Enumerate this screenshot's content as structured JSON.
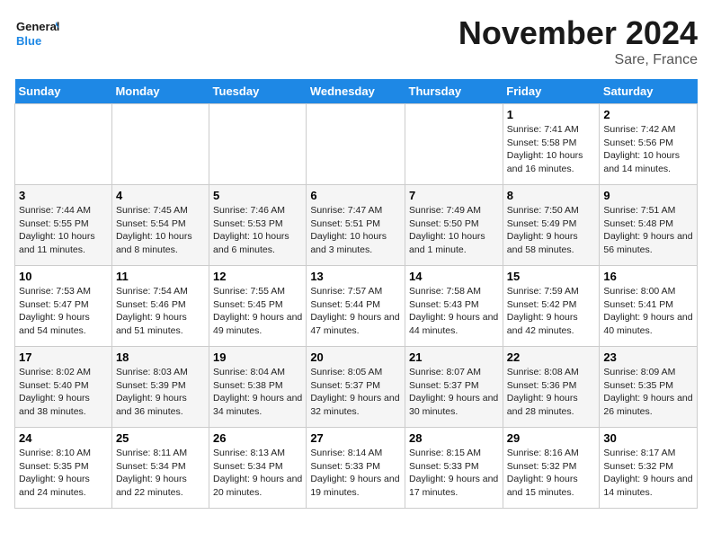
{
  "header": {
    "logo_general": "General",
    "logo_blue": "Blue",
    "title": "November 2024",
    "subtitle": "Sare, France"
  },
  "weekdays": [
    "Sunday",
    "Monday",
    "Tuesday",
    "Wednesday",
    "Thursday",
    "Friday",
    "Saturday"
  ],
  "weeks": [
    [
      {
        "num": "",
        "detail": ""
      },
      {
        "num": "",
        "detail": ""
      },
      {
        "num": "",
        "detail": ""
      },
      {
        "num": "",
        "detail": ""
      },
      {
        "num": "",
        "detail": ""
      },
      {
        "num": "1",
        "detail": "Sunrise: 7:41 AM\nSunset: 5:58 PM\nDaylight: 10 hours and 16 minutes."
      },
      {
        "num": "2",
        "detail": "Sunrise: 7:42 AM\nSunset: 5:56 PM\nDaylight: 10 hours and 14 minutes."
      }
    ],
    [
      {
        "num": "3",
        "detail": "Sunrise: 7:44 AM\nSunset: 5:55 PM\nDaylight: 10 hours and 11 minutes."
      },
      {
        "num": "4",
        "detail": "Sunrise: 7:45 AM\nSunset: 5:54 PM\nDaylight: 10 hours and 8 minutes."
      },
      {
        "num": "5",
        "detail": "Sunrise: 7:46 AM\nSunset: 5:53 PM\nDaylight: 10 hours and 6 minutes."
      },
      {
        "num": "6",
        "detail": "Sunrise: 7:47 AM\nSunset: 5:51 PM\nDaylight: 10 hours and 3 minutes."
      },
      {
        "num": "7",
        "detail": "Sunrise: 7:49 AM\nSunset: 5:50 PM\nDaylight: 10 hours and 1 minute."
      },
      {
        "num": "8",
        "detail": "Sunrise: 7:50 AM\nSunset: 5:49 PM\nDaylight: 9 hours and 58 minutes."
      },
      {
        "num": "9",
        "detail": "Sunrise: 7:51 AM\nSunset: 5:48 PM\nDaylight: 9 hours and 56 minutes."
      }
    ],
    [
      {
        "num": "10",
        "detail": "Sunrise: 7:53 AM\nSunset: 5:47 PM\nDaylight: 9 hours and 54 minutes."
      },
      {
        "num": "11",
        "detail": "Sunrise: 7:54 AM\nSunset: 5:46 PM\nDaylight: 9 hours and 51 minutes."
      },
      {
        "num": "12",
        "detail": "Sunrise: 7:55 AM\nSunset: 5:45 PM\nDaylight: 9 hours and 49 minutes."
      },
      {
        "num": "13",
        "detail": "Sunrise: 7:57 AM\nSunset: 5:44 PM\nDaylight: 9 hours and 47 minutes."
      },
      {
        "num": "14",
        "detail": "Sunrise: 7:58 AM\nSunset: 5:43 PM\nDaylight: 9 hours and 44 minutes."
      },
      {
        "num": "15",
        "detail": "Sunrise: 7:59 AM\nSunset: 5:42 PM\nDaylight: 9 hours and 42 minutes."
      },
      {
        "num": "16",
        "detail": "Sunrise: 8:00 AM\nSunset: 5:41 PM\nDaylight: 9 hours and 40 minutes."
      }
    ],
    [
      {
        "num": "17",
        "detail": "Sunrise: 8:02 AM\nSunset: 5:40 PM\nDaylight: 9 hours and 38 minutes."
      },
      {
        "num": "18",
        "detail": "Sunrise: 8:03 AM\nSunset: 5:39 PM\nDaylight: 9 hours and 36 minutes."
      },
      {
        "num": "19",
        "detail": "Sunrise: 8:04 AM\nSunset: 5:38 PM\nDaylight: 9 hours and 34 minutes."
      },
      {
        "num": "20",
        "detail": "Sunrise: 8:05 AM\nSunset: 5:37 PM\nDaylight: 9 hours and 32 minutes."
      },
      {
        "num": "21",
        "detail": "Sunrise: 8:07 AM\nSunset: 5:37 PM\nDaylight: 9 hours and 30 minutes."
      },
      {
        "num": "22",
        "detail": "Sunrise: 8:08 AM\nSunset: 5:36 PM\nDaylight: 9 hours and 28 minutes."
      },
      {
        "num": "23",
        "detail": "Sunrise: 8:09 AM\nSunset: 5:35 PM\nDaylight: 9 hours and 26 minutes."
      }
    ],
    [
      {
        "num": "24",
        "detail": "Sunrise: 8:10 AM\nSunset: 5:35 PM\nDaylight: 9 hours and 24 minutes."
      },
      {
        "num": "25",
        "detail": "Sunrise: 8:11 AM\nSunset: 5:34 PM\nDaylight: 9 hours and 22 minutes."
      },
      {
        "num": "26",
        "detail": "Sunrise: 8:13 AM\nSunset: 5:34 PM\nDaylight: 9 hours and 20 minutes."
      },
      {
        "num": "27",
        "detail": "Sunrise: 8:14 AM\nSunset: 5:33 PM\nDaylight: 9 hours and 19 minutes."
      },
      {
        "num": "28",
        "detail": "Sunrise: 8:15 AM\nSunset: 5:33 PM\nDaylight: 9 hours and 17 minutes."
      },
      {
        "num": "29",
        "detail": "Sunrise: 8:16 AM\nSunset: 5:32 PM\nDaylight: 9 hours and 15 minutes."
      },
      {
        "num": "30",
        "detail": "Sunrise: 8:17 AM\nSunset: 5:32 PM\nDaylight: 9 hours and 14 minutes."
      }
    ]
  ]
}
